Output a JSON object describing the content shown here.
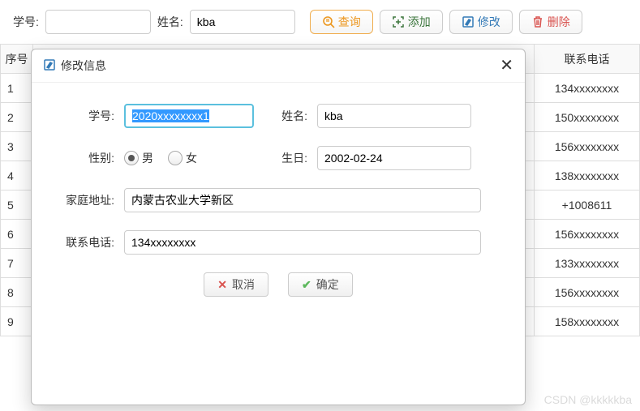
{
  "toolbar": {
    "id_label": "学号:",
    "id_value": "",
    "name_label": "姓名:",
    "name_value": "kba",
    "query": "查询",
    "add": "添加",
    "edit": "修改",
    "delete": "删除"
  },
  "table": {
    "headers": {
      "seq": "序号",
      "phone": "联系电话"
    },
    "rows": [
      {
        "seq": "1",
        "phone": "134xxxxxxxx"
      },
      {
        "seq": "2",
        "phone": "150xxxxxxxx"
      },
      {
        "seq": "3",
        "phone": "156xxxxxxxx"
      },
      {
        "seq": "4",
        "phone": "138xxxxxxxx"
      },
      {
        "seq": "5",
        "phone": "+1008611"
      },
      {
        "seq": "6",
        "phone": "156xxxxxxxx"
      },
      {
        "seq": "7",
        "phone": "133xxxxxxxx"
      },
      {
        "seq": "8",
        "phone": "156xxxxxxxx"
      },
      {
        "seq": "9",
        "phone": "158xxxxxxxx"
      }
    ]
  },
  "dialog": {
    "title": "修改信息",
    "id_label": "学号:",
    "id_value": "2020xxxxxxxx1",
    "name_label": "姓名:",
    "name_value": "kba",
    "gender_label": "性别:",
    "gender_male": "男",
    "gender_female": "女",
    "gender_value": "男",
    "birth_label": "生日:",
    "birth_value": "2002-02-24",
    "addr_label": "家庭地址:",
    "addr_value": "内蒙古农业大学新区",
    "phone_label": "联系电话:",
    "phone_value": "134xxxxxxxx",
    "cancel": "取消",
    "ok": "确定"
  },
  "watermark": "CSDN @kkkkkba"
}
